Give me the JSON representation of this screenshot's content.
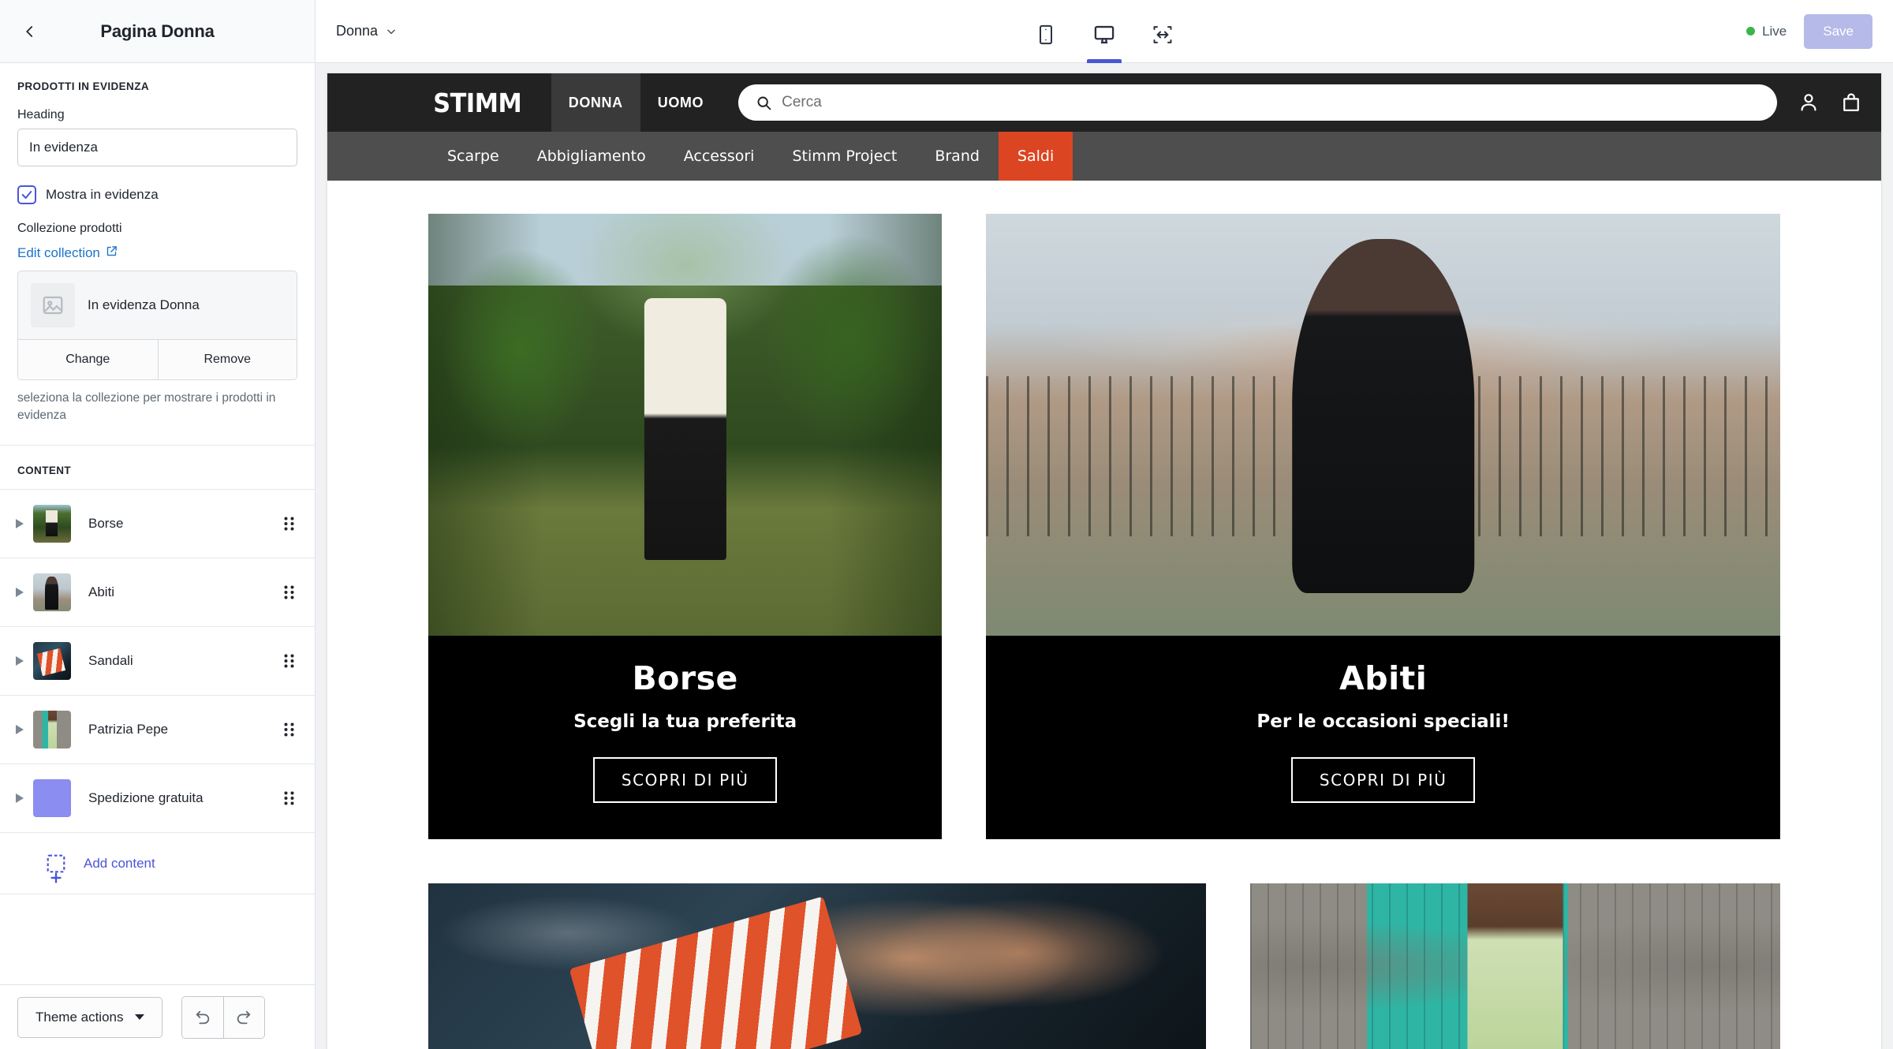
{
  "sidebar": {
    "back_icon": "chevron-left-icon",
    "title": "Pagina Donna",
    "featured_section": {
      "title": "PRODOTTI IN EVIDENZA",
      "heading_label": "Heading",
      "heading_value": "In evidenza",
      "checkbox_label": "Mostra in evidenza",
      "checkbox_checked": true,
      "collection_label": "Collezione prodotti",
      "edit_collection_link": "Edit collection",
      "collection_name": "In evidenza Donna",
      "change_button": "Change",
      "remove_button": "Remove",
      "help_text": "seleziona la collezione per mostrare i prodotti in evidenza"
    },
    "content_section": {
      "title": "CONTENT",
      "items": [
        {
          "label": "Borse",
          "thumb": "t-borse"
        },
        {
          "label": "Abiti",
          "thumb": "t-abiti"
        },
        {
          "label": "Sandali",
          "thumb": "t-sandali2"
        },
        {
          "label": "Patrizia Pepe",
          "thumb": "t-pp"
        },
        {
          "label": "Spedizione gratuita",
          "thumb": "t-ship"
        }
      ],
      "add_content_label": "Add content"
    },
    "footer": {
      "theme_actions_label": "Theme actions",
      "undo_icon": "undo-icon",
      "redo_icon": "redo-icon"
    }
  },
  "topbar": {
    "page_name": "Donna",
    "devices": [
      {
        "name": "mobile",
        "active": false
      },
      {
        "name": "desktop",
        "active": true
      },
      {
        "name": "fullwidth",
        "active": false
      }
    ],
    "live_label": "Live",
    "live_color": "#3bb54a",
    "save_label": "Save",
    "save_disabled": true
  },
  "store": {
    "logo": "STIMM",
    "gender_tabs": [
      {
        "label": "DONNA",
        "active": true
      },
      {
        "label": "UOMO",
        "active": false
      }
    ],
    "search_placeholder": "Cerca",
    "account_icon": "person-icon",
    "cart_icon": "shopping-bag-icon",
    "nav": [
      {
        "label": "Scarpe",
        "sale": false
      },
      {
        "label": "Abbigliamento",
        "sale": false
      },
      {
        "label": "Accessori",
        "sale": false
      },
      {
        "label": "Stimm Project",
        "sale": false
      },
      {
        "label": "Brand",
        "sale": false
      },
      {
        "label": "Saldi",
        "sale": true
      }
    ],
    "sale_color": "#dc4521",
    "cards": [
      {
        "title": "Borse",
        "subtitle": "Scegli la tua preferita",
        "button": "SCOPRI DI PIÙ",
        "photo": "ph-borse"
      },
      {
        "title": "Abiti",
        "subtitle": "Per le occasioni speciali!",
        "button": "SCOPRI DI PIÙ",
        "photo": "ph-abiti"
      }
    ],
    "cards_row2": [
      {
        "photo": "ph-sandali"
      },
      {
        "photo": "ph-pp"
      }
    ]
  }
}
